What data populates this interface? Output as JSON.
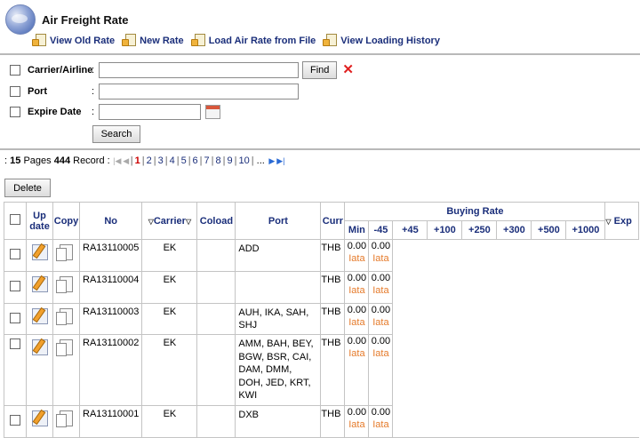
{
  "header": {
    "title": "Air Freight Rate"
  },
  "links": [
    {
      "label": "View Old Rate"
    },
    {
      "label": "New Rate"
    },
    {
      "label": "Load Air Rate from File"
    },
    {
      "label": "View Loading History"
    }
  ],
  "search": {
    "carrier_label": "Carrier/Airline",
    "port_label": "Port",
    "expire_label": "Expire Date",
    "colon": ":",
    "find_label": "Find",
    "search_label": "Search",
    "carrier_value": "",
    "port_value": "",
    "expire_value": ""
  },
  "pager": {
    "prefix": ":",
    "pages": "15",
    "pages_label": "Pages",
    "records": "444",
    "records_label": "Record :",
    "page_numbers": [
      "1",
      "2",
      "3",
      "4",
      "5",
      "6",
      "7",
      "8",
      "9",
      "10"
    ],
    "current": "1",
    "ellipsis": "..."
  },
  "delete_label": "Delete",
  "table": {
    "headers": {
      "update": "Up date",
      "copy": "Copy",
      "no": "No",
      "carrier": "Carrier",
      "coload": "Coload",
      "port": "Port",
      "curr": "Curr",
      "buying_rate": "Buying Rate",
      "min": "Min",
      "m45": "-45",
      "p45": "+45",
      "p100": "+100",
      "p250": "+250",
      "p300": "+300",
      "p500": "+500",
      "p1000": "+1000",
      "expire": "Exp"
    },
    "rows": [
      {
        "no": "RA13110005",
        "carrier": "EK",
        "port": "ADD",
        "curr": "THB",
        "min": "0.00",
        "min_tag": "Iata",
        "m45": "0.00",
        "m45_tag": "Iata"
      },
      {
        "no": "RA13110004",
        "carrier": "EK",
        "port": "",
        "curr": "THB",
        "min": "0.00",
        "min_tag": "Iata",
        "m45": "0.00",
        "m45_tag": "Iata"
      },
      {
        "no": "RA13110003",
        "carrier": "EK",
        "port": "AUH, IKA, SAH, SHJ",
        "curr": "THB",
        "min": "0.00",
        "min_tag": "Iata",
        "m45": "0.00",
        "m45_tag": "Iata"
      },
      {
        "no": "RA13110002",
        "carrier": "EK",
        "port": "AMM, BAH, BEY, BGW, BSR, CAI, DAM, DMM, DOH, JED, KRT, KWI",
        "curr": "THB",
        "min": "0.00",
        "min_tag": "Iata",
        "m45": "0.00",
        "m45_tag": "Iata"
      },
      {
        "no": "RA13110001",
        "carrier": "EK",
        "port": "DXB",
        "curr": "THB",
        "min": "0.00",
        "min_tag": "Iata",
        "m45": "0.00",
        "m45_tag": "Iata"
      }
    ]
  },
  "colors": {
    "link": "#1a2e7a",
    "iata": "#e57a2a",
    "current_page": "#cc0000",
    "clear_x": "#e02020"
  }
}
